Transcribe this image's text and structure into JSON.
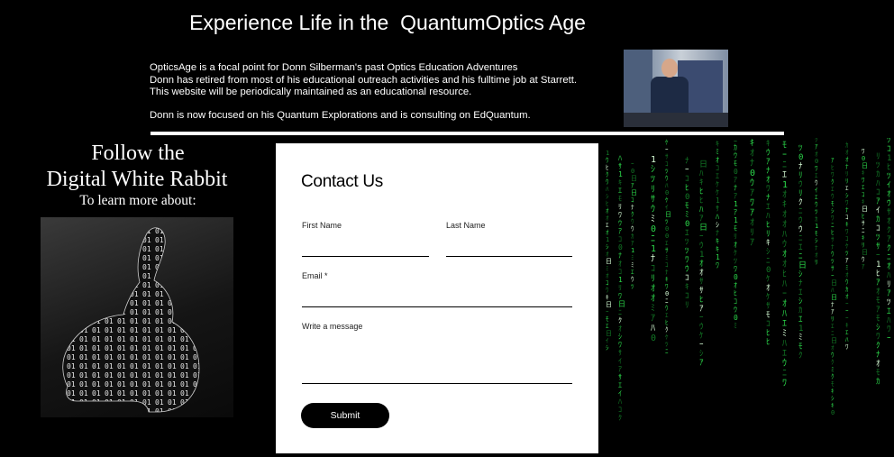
{
  "header": {
    "title": "Experience Life in the  QuantumOptics Age"
  },
  "intro": {
    "line1": "OpticsAge is a focal point for Donn Silberman's past Optics Education Adventures",
    "line2": "Donn has retired from most of his educational outreach activities and his fulltime job at Starrett.",
    "line3": "This website will be periodically maintained as an educational resource.",
    "line4": "Donn is now focused on his Quantum Explorations and is consulting on EdQuantum."
  },
  "promo": {
    "line1": "Follow the",
    "line2": "Digital White Rabbit",
    "line3": "To learn more about:"
  },
  "contact_form": {
    "title": "Contact Us",
    "first_name_label": "First Name",
    "last_name_label": "Last Name",
    "email_label": "Email *",
    "message_label": "Write a message",
    "submit_label": "Submit"
  },
  "icons": {
    "photo": "person-photo",
    "rabbit": "digital-rabbit-image",
    "matrix": "matrix-code-image"
  },
  "colors": {
    "background": "#000000",
    "matrix_green": "#2bd94a",
    "form_background": "#ffffff",
    "button": "#000000"
  }
}
